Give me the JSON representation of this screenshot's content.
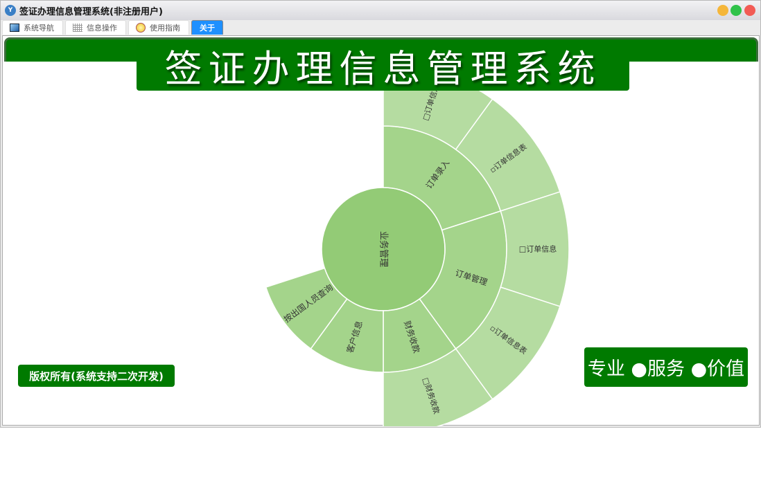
{
  "window": {
    "title": "签证办理信息管理系统(非注册用户)",
    "controls": {
      "minimize_color": "#f5b63a",
      "maximize_color": "#2fc24a",
      "close_color": "#f25b55"
    }
  },
  "tabs": [
    {
      "label": "系统导航",
      "icon": "monitor-icon"
    },
    {
      "label": "信息操作",
      "icon": "grid-icon"
    },
    {
      "label": "使用指南",
      "icon": "bulb-icon"
    },
    {
      "label": "关于",
      "active": true
    }
  ],
  "header": {
    "title": "签证办理信息管理系统"
  },
  "footer": {
    "copyright": "版权所有(系统支持二次开发)",
    "slogan": "专业 ●服务 ●价值"
  },
  "colors": {
    "brand": "#007a00",
    "ring1": "#93cb76",
    "ring2": "#a4d48b",
    "ring3": "#b5dca1"
  },
  "chart_data": {
    "type": "sunburst",
    "root": {
      "name": "业务管理",
      "children": [
        {
          "name": "订单录入",
          "value": 2,
          "children": [
            {
              "name": "□订单信息",
              "value": 1
            },
            {
              "name": "▫订单信息表",
              "value": 1
            }
          ]
        },
        {
          "name": "订单管理",
          "value": 2,
          "children": [
            {
              "name": "□订单信息",
              "value": 1
            },
            {
              "name": "▫订单信息表",
              "value": 1
            }
          ]
        },
        {
          "name": "财务收款",
          "value": 1,
          "children": [
            {
              "name": "□财务收款",
              "value": 1
            }
          ]
        },
        {
          "name": "客户信息",
          "value": 1,
          "children": []
        },
        {
          "name": "按出国人员查询",
          "value": 1,
          "children": []
        }
      ]
    },
    "full_circle_value": 10
  }
}
